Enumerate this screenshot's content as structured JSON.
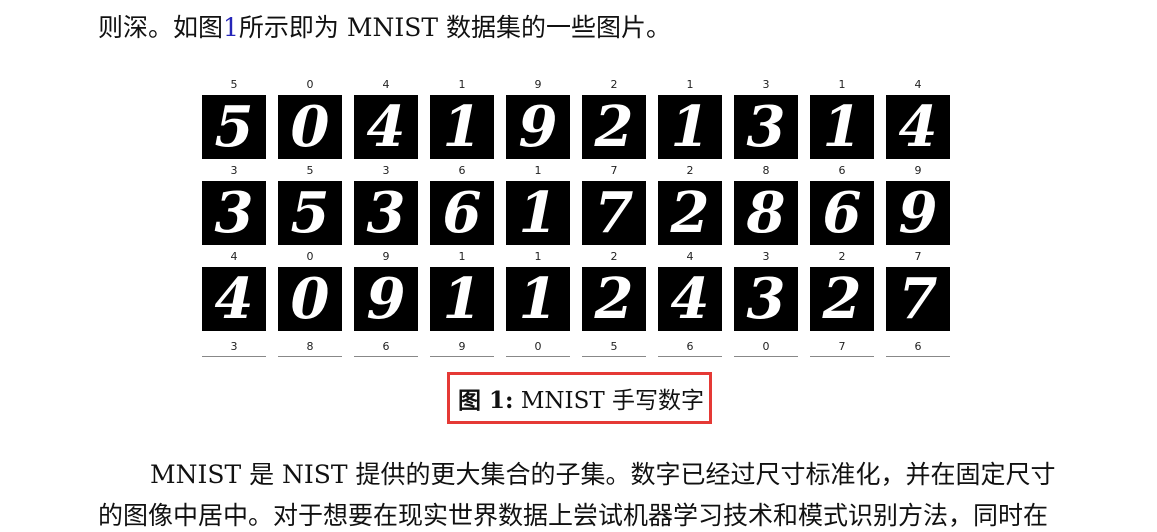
{
  "intro": {
    "before_ref": "则深。如图",
    "ref": "1",
    "after_ref": "所示即为 MNIST 数据集的一些图片。"
  },
  "figure": {
    "true_labels": [
      [
        "5",
        "0",
        "4",
        "1",
        "9",
        "2",
        "1",
        "3",
        "1",
        "4"
      ],
      [
        "3",
        "5",
        "3",
        "6",
        "1",
        "7",
        "2",
        "8",
        "6",
        "9"
      ],
      [
        "4",
        "0",
        "9",
        "1",
        "1",
        "2",
        "4",
        "3",
        "2",
        "7"
      ]
    ],
    "predicted_labels": [
      "3",
      "8",
      "6",
      "9",
      "0",
      "5",
      "6",
      "0",
      "7",
      "6"
    ]
  },
  "caption": {
    "prefix": "图 1:",
    "text": "MNIST 手写数字"
  },
  "paragraph": {
    "line1": "MNIST 是 NIST 提供的更大集合的子集。数字已经过尺寸标准化，并在固定尺寸",
    "line2": "的图像中居中。对于想要在现实世界数据上尝试机器学习技术和模式识别方法，同时在"
  }
}
